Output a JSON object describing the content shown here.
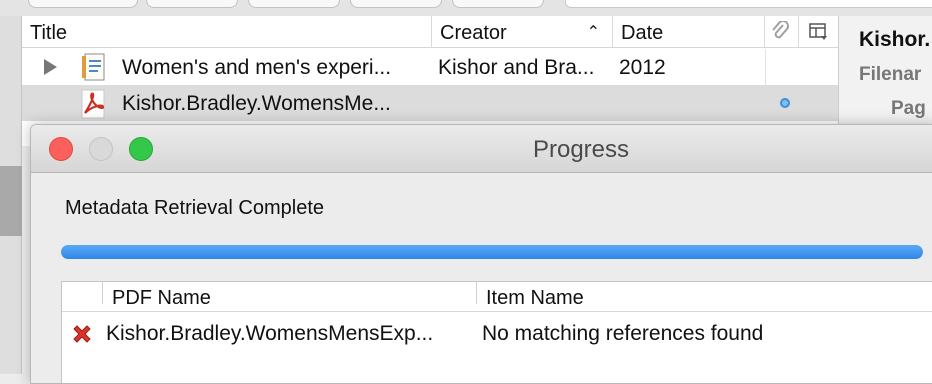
{
  "items_table": {
    "columns": {
      "title": "Title",
      "creator": "Creator",
      "date": "Date"
    },
    "rows": [
      {
        "title": "Women's and men's experi...",
        "creator": "Kishor and Bra...",
        "date": "2012"
      },
      {
        "title": "Kishor.Bradley.WomensMe...",
        "creator": "",
        "date": ""
      }
    ]
  },
  "right_pane": {
    "line1": "Kishor.",
    "line2": "Filenar",
    "line3": "Pag"
  },
  "dialog": {
    "title": "Progress",
    "status": "Metadata Retrieval Complete",
    "progress_fraction": 1.0,
    "results_columns": {
      "pdf_name": "PDF Name",
      "item_name": "Item Name"
    },
    "results_rows": [
      {
        "pdf_name": "Kishor.Bradley.WomensMensExp...",
        "item_name": "No matching references found",
        "status_icon": "error-x-icon"
      }
    ]
  },
  "colors": {
    "accent": "#2f86e6",
    "selected_row": "#dcdcdc",
    "error": "#d9342b"
  }
}
